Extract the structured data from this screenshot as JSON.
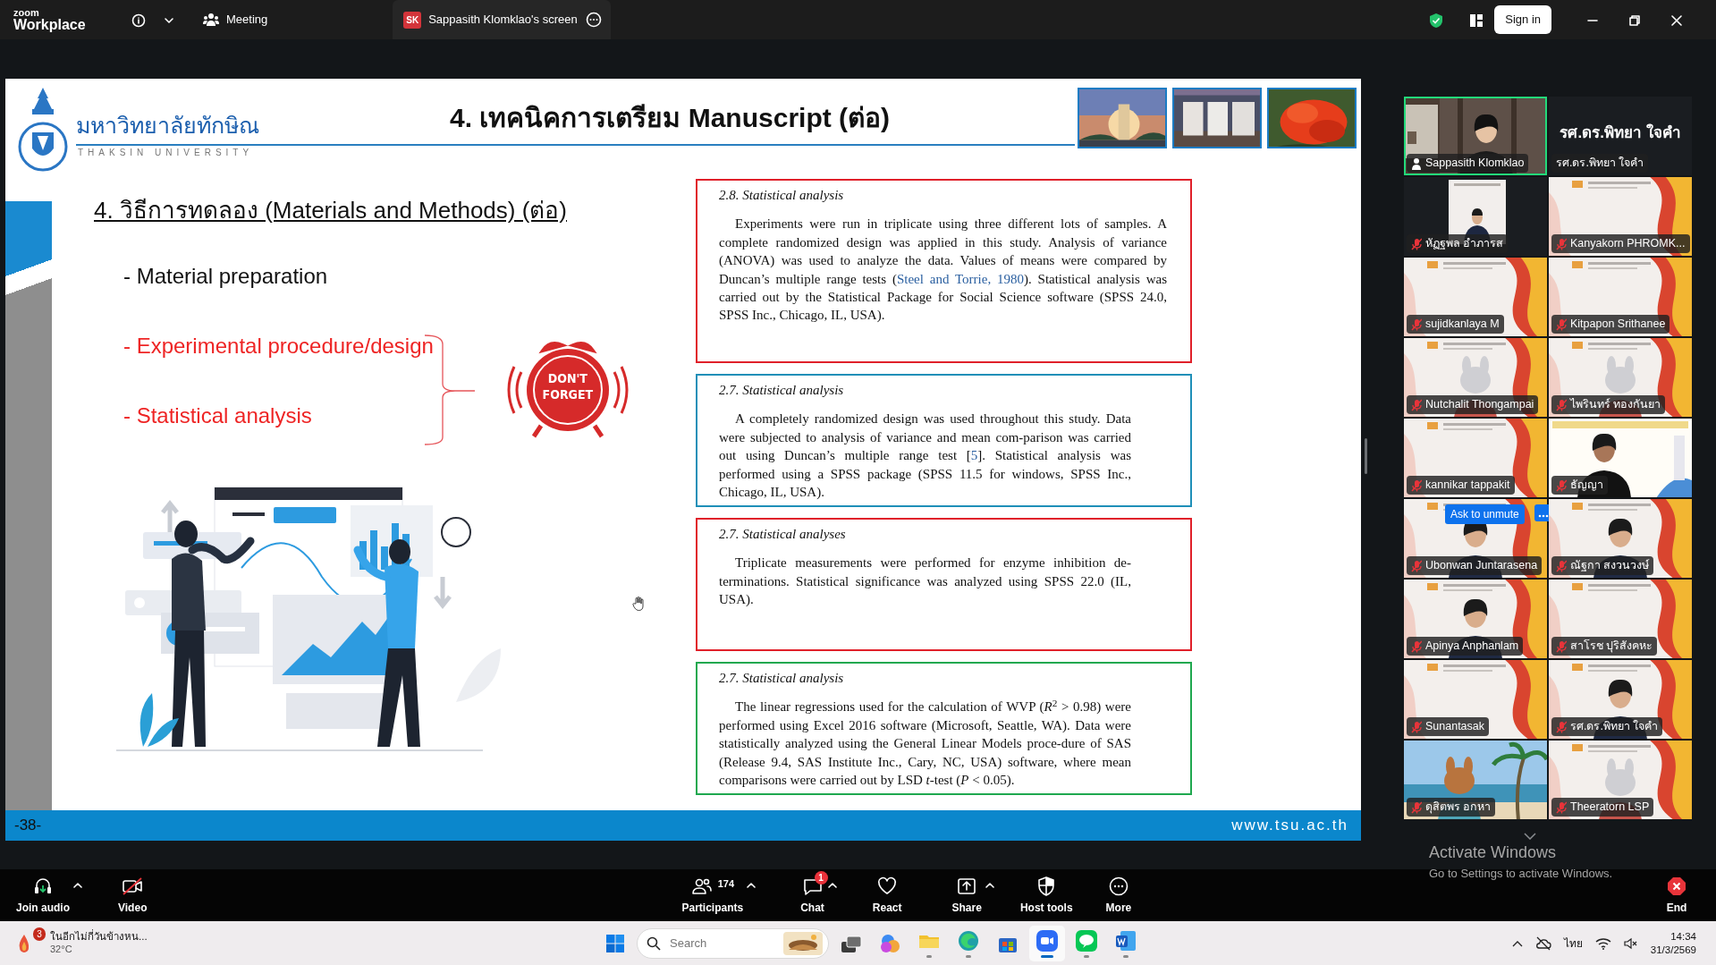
{
  "top_bar": {
    "logo_top": "zoom",
    "logo_bottom": "Workplace",
    "meeting_label": "Meeting",
    "share_tab": {
      "badge": "SK",
      "label": "Sappasith Klomklao's screen"
    },
    "sign_in": "Sign in"
  },
  "slide": {
    "university_name": "มหาวิทยาลัยทักษิณ",
    "university_name_en": "THAKSIN UNIVERSITY",
    "title": "4. เทคนิคการเตรียม Manuscript (ต่อ)",
    "heading": "4. วิธีการทดลอง (Materials and Methods) (ต่อ)",
    "bullets": [
      {
        "text": "- Material preparation",
        "highlighted": false
      },
      {
        "text": "- Experimental procedure/design",
        "highlighted": true
      },
      {
        "text": "- Statistical analysis",
        "highlighted": true
      }
    ],
    "sticker_text": "DON'T FORGET",
    "excerpts": [
      {
        "heading": "2.8.  Statistical analysis",
        "color": "#e0202a",
        "wide": true,
        "segments": [
          {
            "text": "Experiments were run in triplicate using three different lots of samples. A complete randomized design was applied in this study. Analysis of variance (ANOVA) was used to analyze the data. Values of means were compared by Duncan’s multiple range tests (",
            "citation": false
          },
          {
            "text": "Steel and Torrie, 1980",
            "citation": true
          },
          {
            "text": "). Statistical analysis was carried out by the Statistical Package for Social Science software (SPSS 24.0, SPSS Inc., Chicago, IL, USA).",
            "citation": false
          }
        ]
      },
      {
        "heading": "2.7.  Statistical analysis",
        "color": "#1f8fb8",
        "wide": false,
        "segments": [
          {
            "text": "A completely randomized design was used throughout this study. Data were subjected to analysis of variance and mean com-parison was carried out using Duncan’s multiple range test [",
            "citation": false
          },
          {
            "text": "5",
            "citation": true
          },
          {
            "text": "]. Statistical analysis was performed using a SPSS package (SPSS 11.5 for windows, SPSS Inc., Chicago, IL, USA).",
            "citation": false
          }
        ]
      },
      {
        "heading": "2.7.  Statistical analyses",
        "color": "#e0202a",
        "wide": false,
        "segments": [
          {
            "text": "Triplicate measurements were performed for enzyme inhibition de-terminations. Statistical significance was analyzed using SPSS 22.0 (IL, USA).",
            "citation": false
          }
        ]
      },
      {
        "heading": "2.7. Statistical analysis",
        "color": "#1fa84f",
        "wide": false,
        "segments": [
          {
            "text": "The linear regressions used for the calculation of WVP (*R*$^{2}$ > 0.98) were performed using Excel 2016 software (Microsoft, Seattle, WA). Data were statistically analyzed using the General Linear Models proce-dure of SAS (Release 9.4, SAS Institute Inc., Cary, NC, USA) software, where mean comparisons were carried out by LSD *t*-test (*P* < 0.05).",
            "citation": false
          }
        ]
      }
    ],
    "page_number": "-38-",
    "website": "www.tsu.ac.th"
  },
  "gallery": {
    "ask_to_unmute": "Ask to unmute",
    "tiles": [
      {
        "kind": "video",
        "name": "Sappasith Klomklao",
        "muted": false,
        "speaking": true,
        "hover": false
      },
      {
        "kind": "name",
        "display_name": "รศ.ดร.พิทยา ใจคำ",
        "name": "รศ.ดร.พิทยา  ใจคำ",
        "muted": false,
        "speaking": false,
        "hover": false
      },
      {
        "kind": "video",
        "name": "หัฏฐพล อำภารส",
        "muted": true,
        "speaking": false,
        "hover": false
      },
      {
        "kind": "video",
        "name": "Kanyakorn PHROMK...",
        "muted": true,
        "speaking": false,
        "hover": false
      },
      {
        "kind": "video",
        "name": "sujidkanlaya M",
        "muted": true,
        "speaking": false,
        "hover": false
      },
      {
        "kind": "video",
        "name": "Kitpapon Srithanee",
        "muted": true,
        "speaking": false,
        "hover": false
      },
      {
        "kind": "video",
        "name": "Nutchalit Thongampai",
        "muted": true,
        "speaking": false,
        "hover": false
      },
      {
        "kind": "video",
        "name": "ไพรินทร์ ทองกันยา",
        "muted": true,
        "speaking": false,
        "hover": false
      },
      {
        "kind": "video",
        "name": "kannikar tappakit",
        "muted": true,
        "speaking": false,
        "hover": false
      },
      {
        "kind": "video",
        "name": "ธัญญา",
        "muted": true,
        "speaking": false,
        "hover": false
      },
      {
        "kind": "video",
        "name": "Ubonwan Juntarasena",
        "muted": true,
        "speaking": false,
        "hover": true
      },
      {
        "kind": "video",
        "name": "ณัฐกา สงวนวงษ์",
        "muted": true,
        "speaking": false,
        "hover": false
      },
      {
        "kind": "video",
        "name": "Apinya Anphanlam",
        "muted": true,
        "speaking": false,
        "hover": false
      },
      {
        "kind": "video",
        "name": "สาโรช ปุริสังคหะ",
        "muted": true,
        "speaking": false,
        "hover": false
      },
      {
        "kind": "video",
        "name": "Sunantasak",
        "muted": true,
        "speaking": false,
        "hover": false
      },
      {
        "kind": "video",
        "name": "รศ.ดร.พิทยา  ใจคำ",
        "muted": true,
        "speaking": false,
        "hover": false
      },
      {
        "kind": "video",
        "name": "ดุสิตพร อกหา",
        "muted": true,
        "speaking": false,
        "hover": false
      },
      {
        "kind": "video",
        "name": "Theeratorn LSP",
        "muted": true,
        "speaking": false,
        "hover": false
      }
    ]
  },
  "toolbar": [
    {
      "label": "Join audio",
      "caret": true
    },
    {
      "label": "Video",
      "caret": false
    },
    {
      "label": "Participants",
      "count": "174",
      "caret": true
    },
    {
      "label": "Chat",
      "badge": "1",
      "caret": true
    },
    {
      "label": "React",
      "caret": false
    },
    {
      "label": "Share",
      "caret": true
    },
    {
      "label": "Host tools",
      "caret": false
    },
    {
      "label": "More",
      "caret": false
    }
  ],
  "end_button": "End",
  "activation": {
    "title": "Activate Windows",
    "subtitle": "Go to Settings to activate Windows."
  },
  "taskbar": {
    "weather_text": "ในอีกไม่กี่วันข้างหน...",
    "weather_badge": "3",
    "temperature": "32°C",
    "search_placeholder": "Search",
    "apps": [
      {
        "running": false,
        "active": false
      },
      {
        "running": false,
        "active": false
      },
      {
        "running": true,
        "active": false
      },
      {
        "running": true,
        "active": false
      },
      {
        "running": false,
        "active": false
      },
      {
        "running": true,
        "active": true
      },
      {
        "running": true,
        "active": false
      },
      {
        "running": true,
        "active": false
      }
    ],
    "language": "ไทย",
    "time": "14:34",
    "date": "31/3/2569"
  }
}
